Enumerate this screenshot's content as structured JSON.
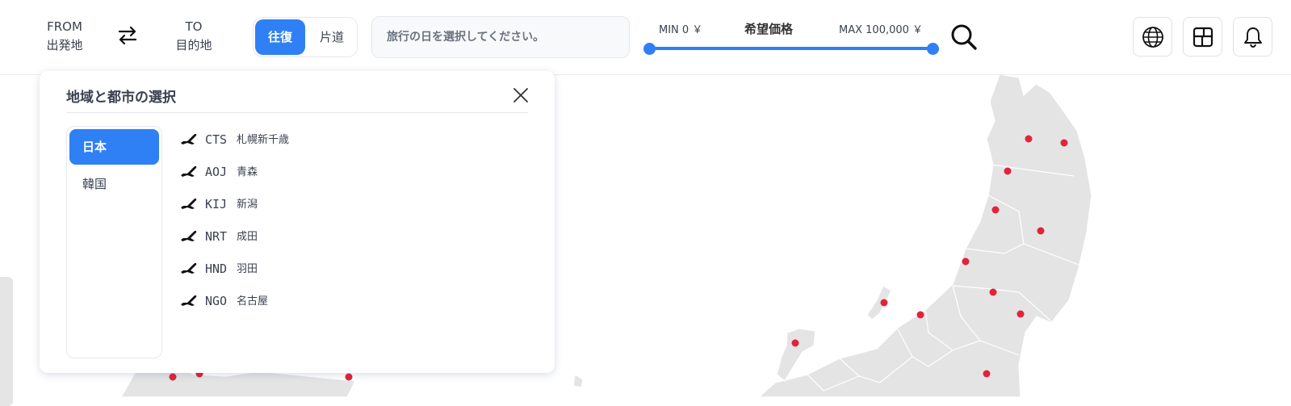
{
  "header": {
    "from_en": "FROM",
    "from_ja": "出発地",
    "to_en": "TO",
    "to_ja": "目的地",
    "trip_round": "往復",
    "trip_oneway": "片道",
    "date_placeholder": "旅行の日を選択してください。",
    "price_min": "MIN 0 ￥",
    "price_title": "希望価格",
    "price_max": "MAX 100,000 ￥",
    "icons": [
      "swap-arrows-icon",
      "search-icon",
      "globe-icon",
      "layout-icon",
      "bell-icon"
    ]
  },
  "panel": {
    "title": "地域と都市の選択",
    "regions": [
      {
        "label": "日本",
        "selected": true
      },
      {
        "label": "韓国",
        "selected": false
      }
    ],
    "airports": [
      {
        "code": "CTS",
        "city": "札幌新千歳"
      },
      {
        "code": "AOJ",
        "city": "青森"
      },
      {
        "code": "KIJ",
        "city": "新潟"
      },
      {
        "code": "NRT",
        "city": "成田"
      },
      {
        "code": "HND",
        "city": "羽田"
      },
      {
        "code": "NGO",
        "city": "名古屋"
      }
    ]
  },
  "colors": {
    "accent": "#2f80f4",
    "map_land": "#e4e4e4",
    "map_dot": "#e0243a"
  }
}
